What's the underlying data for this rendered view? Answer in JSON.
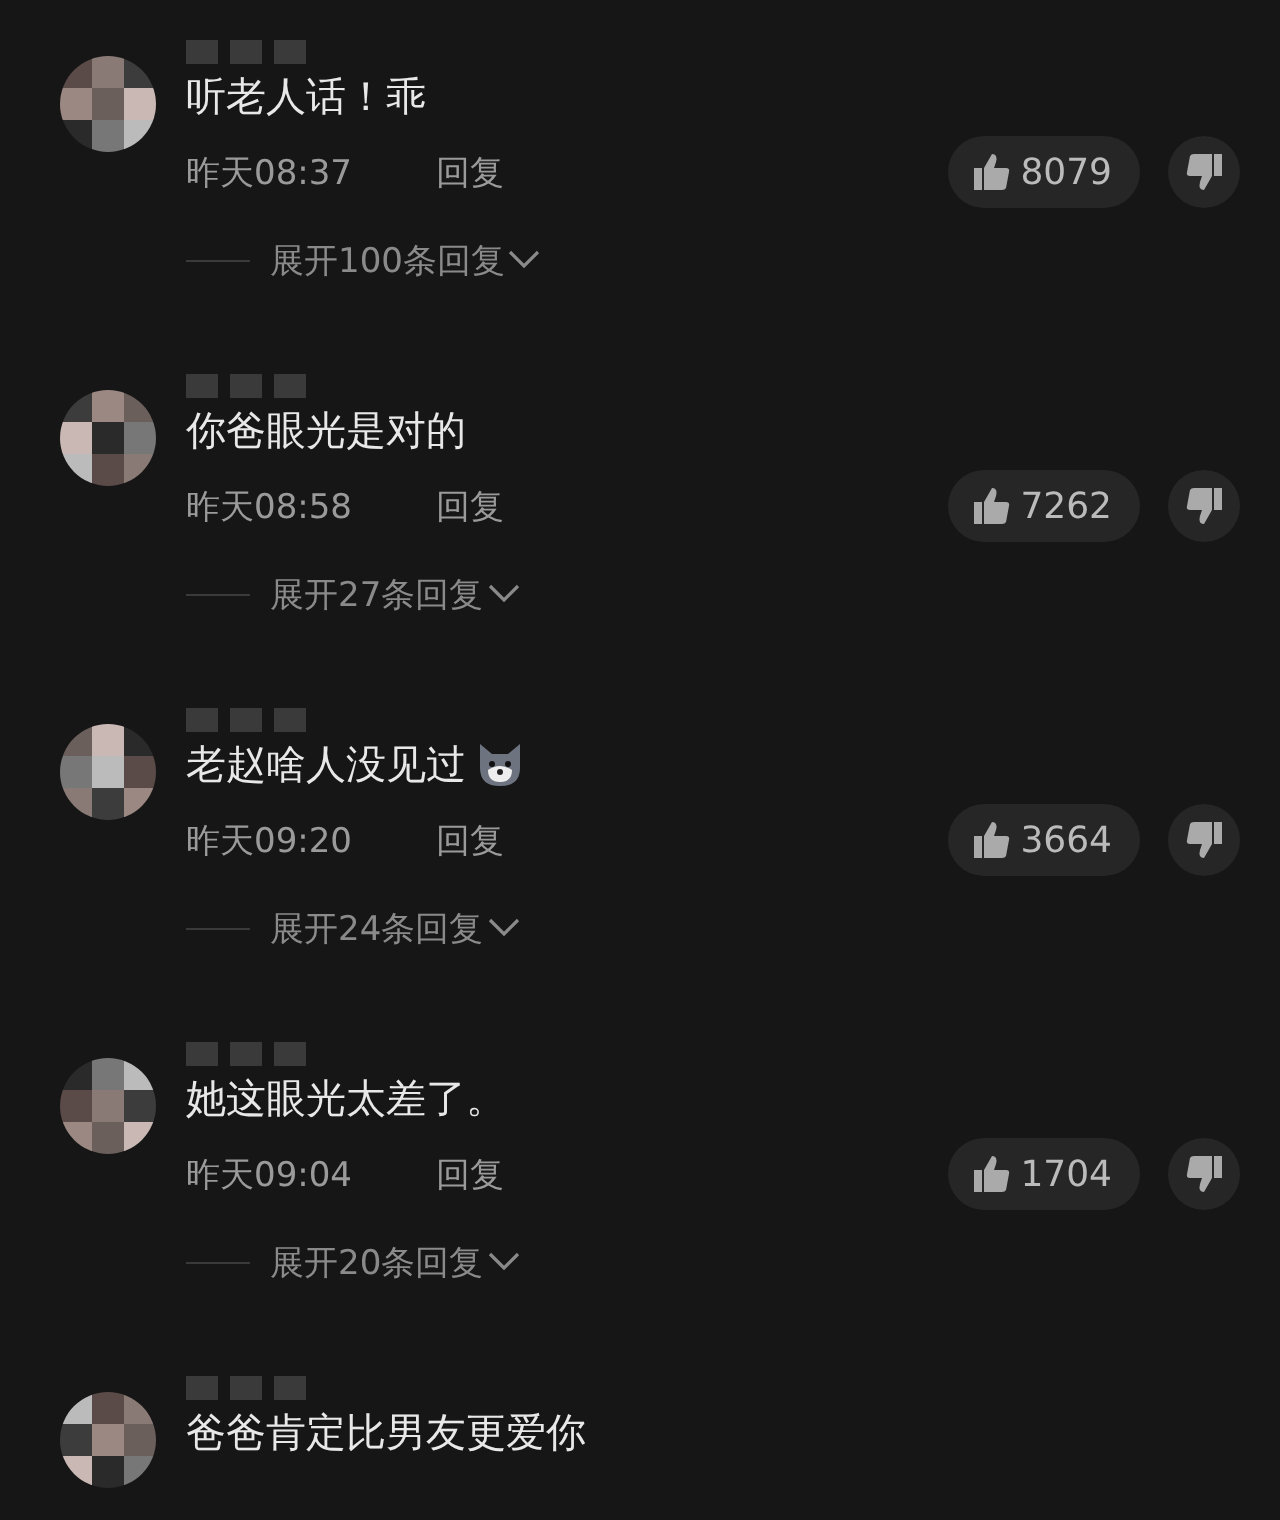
{
  "comments": [
    {
      "text": "听老人话！乖",
      "time": "昨天08:37",
      "reply": "回复",
      "likes": "8079",
      "expand": "展开100条回复",
      "emoji": false
    },
    {
      "text": "你爸眼光是对的",
      "time": "昨天08:58",
      "reply": "回复",
      "likes": "7262",
      "expand": "展开27条回复",
      "emoji": false
    },
    {
      "text": "老赵啥人没见过",
      "time": "昨天09:20",
      "reply": "回复",
      "likes": "3664",
      "expand": "展开24条回复",
      "emoji": true
    },
    {
      "text": "她这眼光太差了。",
      "time": "昨天09:04",
      "reply": "回复",
      "likes": "1704",
      "expand": "展开20条回复",
      "emoji": false
    },
    {
      "text": "爸爸肯定比男友更爱你",
      "emoji": false
    }
  ]
}
